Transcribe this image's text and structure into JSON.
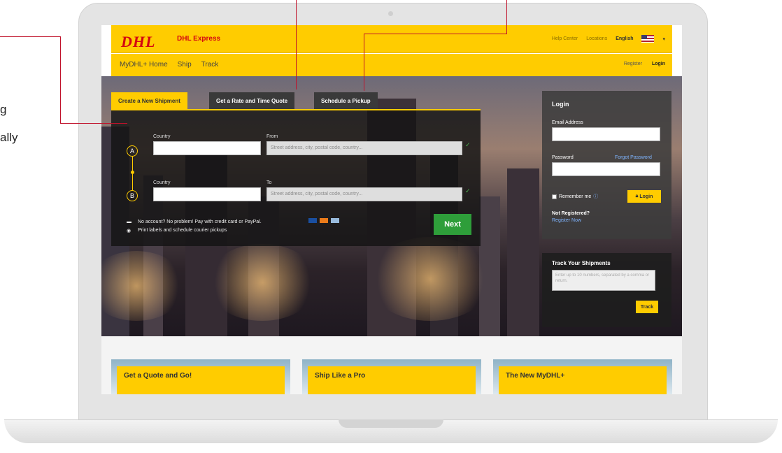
{
  "annotation": {
    "line1": "g",
    "line2": "ally"
  },
  "header": {
    "logo": "DHL",
    "product": "DHL Express",
    "links": [
      "Help Center",
      "Locations"
    ],
    "language": "English",
    "nav": [
      "MyDHL+ Home",
      "Ship",
      "Track"
    ],
    "register": "Register",
    "login": "Login"
  },
  "tabs": [
    "Create a New Shipment",
    "Get a Rate and Time Quote",
    "Schedule a Pickup"
  ],
  "shipment": {
    "point_a": "A",
    "point_b": "B",
    "country_label": "Country",
    "from_label": "From",
    "to_label": "To",
    "address_placeholder": "Street address, city, postal code, country...",
    "info1": "No account? No problem! Pay with credit card or PayPal.",
    "info2": "Print labels and schedule courier pickups",
    "next": "Next"
  },
  "login": {
    "title": "Login",
    "email_label": "Email Address",
    "password_label": "Password",
    "forgot": "Forgot Password",
    "remember": "Remember me",
    "login_button": "Login",
    "not_registered": "Not Registered?",
    "register_now": "Register Now"
  },
  "track": {
    "title": "Track Your Shipments",
    "placeholder": "Enter up to 10 numbers, separated by a comma or return.",
    "button": "Track"
  },
  "cards": [
    "Get a Quote and Go!",
    "Ship Like a Pro",
    "The New MyDHL+"
  ]
}
